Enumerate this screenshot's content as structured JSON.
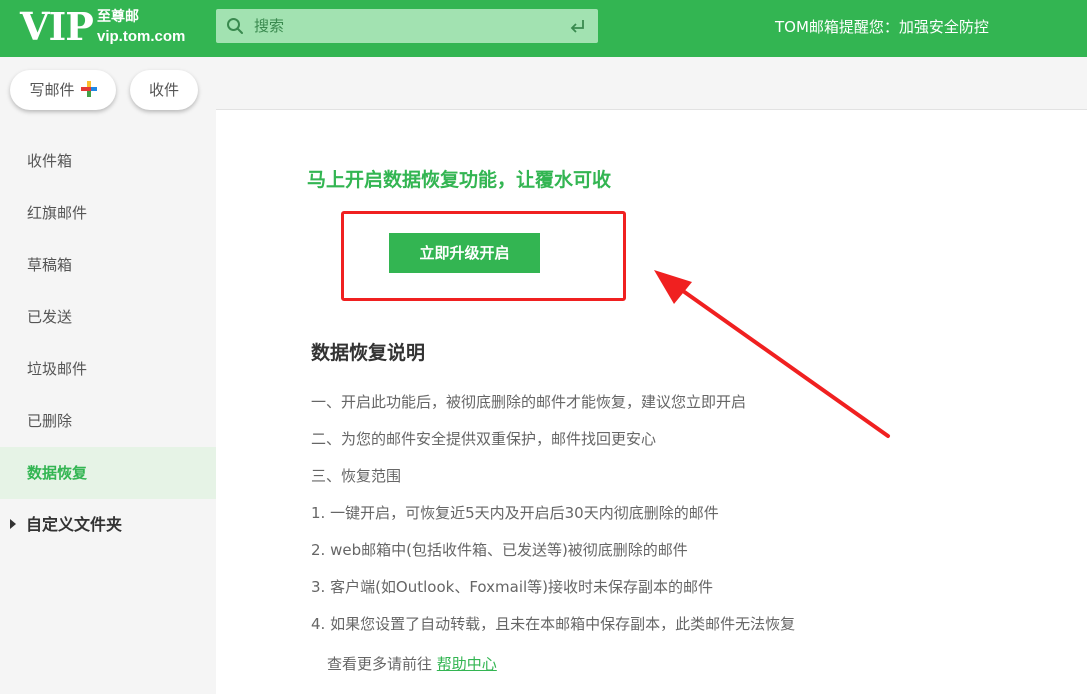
{
  "header": {
    "logo_text": "VIP",
    "logo_line1": "至尊邮",
    "logo_line2": "vip.tom.com",
    "search_placeholder": "搜索",
    "notice": "TOM邮箱提醒您：加强安全防控"
  },
  "colors": {
    "brand_green": "#33b552",
    "highlight_red": "#f02020"
  },
  "sidebar": {
    "compose_label": "写邮件",
    "receive_label": "收件",
    "items": [
      {
        "label": "收件箱",
        "active": false
      },
      {
        "label": "红旗邮件",
        "active": false
      },
      {
        "label": "草稿箱",
        "active": false
      },
      {
        "label": "已发送",
        "active": false
      },
      {
        "label": "垃圾邮件",
        "active": false
      },
      {
        "label": "已删除",
        "active": false
      },
      {
        "label": "数据恢复",
        "active": true
      }
    ],
    "custom_folder": "自定义文件夹"
  },
  "main": {
    "title": "马上开启数据恢复功能，让覆水可收",
    "upgrade_button": "立即升级开启",
    "section_title": "数据恢复说明",
    "lines": [
      "一、开启此功能后，被彻底删除的邮件才能恢复，建议您立即开启",
      "二、为您的邮件安全提供双重保护，邮件找回更安心",
      "三、恢复范围",
      "1. 一键开启，可恢复近5天内及开启后30天内彻底删除的邮件",
      "2. web邮箱中(包括收件箱、已发送等)被彻底删除的邮件",
      "3. 客户端(如Outlook、Foxmail等)接收时未保存副本的邮件",
      "4. 如果您设置了自动转载，且未在本邮箱中保存副本，此类邮件无法恢复"
    ],
    "help_prefix": "查看更多请前往",
    "help_link": "帮助中心"
  },
  "icons": {
    "search": "search-icon",
    "enter": "enter-icon",
    "plus": "plus-icon",
    "expand": "caret-right-icon",
    "annotation_arrow": "red-arrow"
  }
}
